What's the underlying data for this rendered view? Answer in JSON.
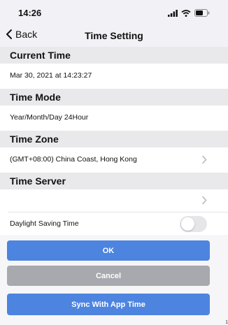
{
  "status_bar": {
    "time": "14:26",
    "icons": [
      "signal-icon",
      "wifi-icon",
      "battery-icon"
    ]
  },
  "nav": {
    "back_label": "Back",
    "title": "Time Setting"
  },
  "sections": {
    "current_time": {
      "header": "Current Time",
      "value": "Mar 30, 2021 at 14:23:27"
    },
    "time_mode": {
      "header": "Time Mode",
      "value": "Year/Month/Day 24Hour"
    },
    "time_zone": {
      "header": "Time Zone",
      "value": "(GMT+08:00) China Coast, Hong Kong"
    },
    "time_server": {
      "header": "Time Server",
      "value": ""
    }
  },
  "daylight_saving": {
    "label": "Daylight Saving Time",
    "enabled": false
  },
  "buttons": {
    "ok_label": "OK",
    "cancel_label": "Cancel",
    "sync_label": "Sync With App Time"
  },
  "edge_mark": "1",
  "colors": {
    "primary_button": "#4d84e0",
    "cancel_button": "#a7a9ae",
    "section_header": "#e9e9ec",
    "toggle_off": "#e6e6e9"
  }
}
